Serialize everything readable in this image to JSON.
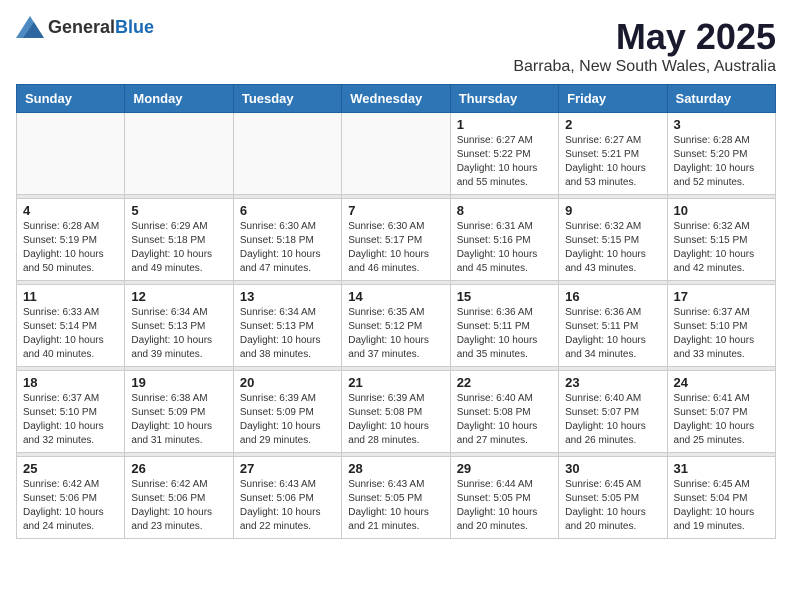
{
  "header": {
    "logo_general": "General",
    "logo_blue": "Blue",
    "title": "May 2025",
    "subtitle": "Barraba, New South Wales, Australia"
  },
  "calendar": {
    "days_of_week": [
      "Sunday",
      "Monday",
      "Tuesday",
      "Wednesday",
      "Thursday",
      "Friday",
      "Saturday"
    ],
    "weeks": [
      [
        {
          "day": "",
          "info": ""
        },
        {
          "day": "",
          "info": ""
        },
        {
          "day": "",
          "info": ""
        },
        {
          "day": "",
          "info": ""
        },
        {
          "day": "1",
          "info": "Sunrise: 6:27 AM\nSunset: 5:22 PM\nDaylight: 10 hours\nand 55 minutes."
        },
        {
          "day": "2",
          "info": "Sunrise: 6:27 AM\nSunset: 5:21 PM\nDaylight: 10 hours\nand 53 minutes."
        },
        {
          "day": "3",
          "info": "Sunrise: 6:28 AM\nSunset: 5:20 PM\nDaylight: 10 hours\nand 52 minutes."
        }
      ],
      [
        {
          "day": "4",
          "info": "Sunrise: 6:28 AM\nSunset: 5:19 PM\nDaylight: 10 hours\nand 50 minutes."
        },
        {
          "day": "5",
          "info": "Sunrise: 6:29 AM\nSunset: 5:18 PM\nDaylight: 10 hours\nand 49 minutes."
        },
        {
          "day": "6",
          "info": "Sunrise: 6:30 AM\nSunset: 5:18 PM\nDaylight: 10 hours\nand 47 minutes."
        },
        {
          "day": "7",
          "info": "Sunrise: 6:30 AM\nSunset: 5:17 PM\nDaylight: 10 hours\nand 46 minutes."
        },
        {
          "day": "8",
          "info": "Sunrise: 6:31 AM\nSunset: 5:16 PM\nDaylight: 10 hours\nand 45 minutes."
        },
        {
          "day": "9",
          "info": "Sunrise: 6:32 AM\nSunset: 5:15 PM\nDaylight: 10 hours\nand 43 minutes."
        },
        {
          "day": "10",
          "info": "Sunrise: 6:32 AM\nSunset: 5:15 PM\nDaylight: 10 hours\nand 42 minutes."
        }
      ],
      [
        {
          "day": "11",
          "info": "Sunrise: 6:33 AM\nSunset: 5:14 PM\nDaylight: 10 hours\nand 40 minutes."
        },
        {
          "day": "12",
          "info": "Sunrise: 6:34 AM\nSunset: 5:13 PM\nDaylight: 10 hours\nand 39 minutes."
        },
        {
          "day": "13",
          "info": "Sunrise: 6:34 AM\nSunset: 5:13 PM\nDaylight: 10 hours\nand 38 minutes."
        },
        {
          "day": "14",
          "info": "Sunrise: 6:35 AM\nSunset: 5:12 PM\nDaylight: 10 hours\nand 37 minutes."
        },
        {
          "day": "15",
          "info": "Sunrise: 6:36 AM\nSunset: 5:11 PM\nDaylight: 10 hours\nand 35 minutes."
        },
        {
          "day": "16",
          "info": "Sunrise: 6:36 AM\nSunset: 5:11 PM\nDaylight: 10 hours\nand 34 minutes."
        },
        {
          "day": "17",
          "info": "Sunrise: 6:37 AM\nSunset: 5:10 PM\nDaylight: 10 hours\nand 33 minutes."
        }
      ],
      [
        {
          "day": "18",
          "info": "Sunrise: 6:37 AM\nSunset: 5:10 PM\nDaylight: 10 hours\nand 32 minutes."
        },
        {
          "day": "19",
          "info": "Sunrise: 6:38 AM\nSunset: 5:09 PM\nDaylight: 10 hours\nand 31 minutes."
        },
        {
          "day": "20",
          "info": "Sunrise: 6:39 AM\nSunset: 5:09 PM\nDaylight: 10 hours\nand 29 minutes."
        },
        {
          "day": "21",
          "info": "Sunrise: 6:39 AM\nSunset: 5:08 PM\nDaylight: 10 hours\nand 28 minutes."
        },
        {
          "day": "22",
          "info": "Sunrise: 6:40 AM\nSunset: 5:08 PM\nDaylight: 10 hours\nand 27 minutes."
        },
        {
          "day": "23",
          "info": "Sunrise: 6:40 AM\nSunset: 5:07 PM\nDaylight: 10 hours\nand 26 minutes."
        },
        {
          "day": "24",
          "info": "Sunrise: 6:41 AM\nSunset: 5:07 PM\nDaylight: 10 hours\nand 25 minutes."
        }
      ],
      [
        {
          "day": "25",
          "info": "Sunrise: 6:42 AM\nSunset: 5:06 PM\nDaylight: 10 hours\nand 24 minutes."
        },
        {
          "day": "26",
          "info": "Sunrise: 6:42 AM\nSunset: 5:06 PM\nDaylight: 10 hours\nand 23 minutes."
        },
        {
          "day": "27",
          "info": "Sunrise: 6:43 AM\nSunset: 5:06 PM\nDaylight: 10 hours\nand 22 minutes."
        },
        {
          "day": "28",
          "info": "Sunrise: 6:43 AM\nSunset: 5:05 PM\nDaylight: 10 hours\nand 21 minutes."
        },
        {
          "day": "29",
          "info": "Sunrise: 6:44 AM\nSunset: 5:05 PM\nDaylight: 10 hours\nand 20 minutes."
        },
        {
          "day": "30",
          "info": "Sunrise: 6:45 AM\nSunset: 5:05 PM\nDaylight: 10 hours\nand 20 minutes."
        },
        {
          "day": "31",
          "info": "Sunrise: 6:45 AM\nSunset: 5:04 PM\nDaylight: 10 hours\nand 19 minutes."
        }
      ]
    ]
  }
}
